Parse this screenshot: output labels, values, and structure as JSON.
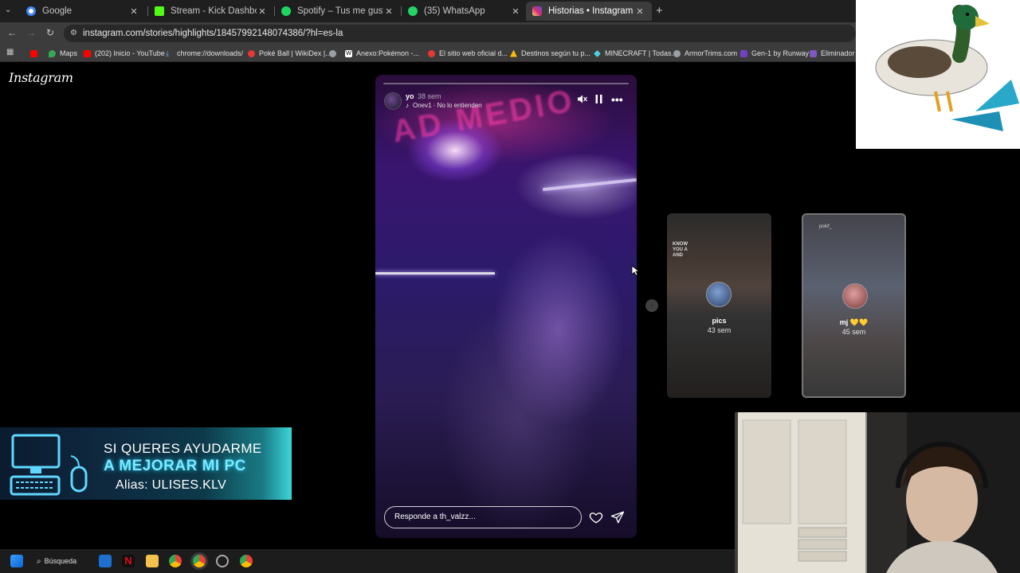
{
  "browser": {
    "tabs": [
      {
        "label": "Google",
        "icon": "google-icon",
        "color": "#4285f4",
        "active": false
      },
      {
        "label": "Stream - Kick Dashboard",
        "icon": "kick-icon",
        "color": "#53fc18",
        "active": false
      },
      {
        "label": "Spotify – Tus me gusta",
        "icon": "spotify-icon",
        "color": "#1ed760",
        "active": false
      },
      {
        "label": "(35) WhatsApp",
        "icon": "whatsapp-icon",
        "color": "#25d366",
        "active": false
      },
      {
        "label": "Historias • Instagram",
        "icon": "instagram-icon",
        "color": "#e1306c",
        "active": true
      }
    ],
    "new_tab": "+",
    "url": "instagram.com/stories/highlights/18457992148074386/?hl=es-la",
    "bookmarks": [
      {
        "label": "",
        "icon": "youtube-icon",
        "color": "#ff0000"
      },
      {
        "label": "Maps",
        "icon": "maps-icon",
        "color": "#34a853"
      },
      {
        "label": "(202) Inicio - YouTube",
        "icon": "youtube-icon",
        "color": "#ff0000"
      },
      {
        "label": "chrome://downloads/",
        "icon": "download-icon",
        "color": "#8ab4f8"
      },
      {
        "label": "Poké Ball | WikiDex |...",
        "icon": "pokeball-icon",
        "color": "#e53935"
      },
      {
        "label": "",
        "icon": "globe-icon",
        "color": "#9aa0a6"
      },
      {
        "label": "Anexo:Pokémon -...",
        "icon": "wikipedia-icon",
        "color": "#ffffff"
      },
      {
        "label": "El sitio web oficial d...",
        "icon": "pokeball-icon",
        "color": "#e53935"
      },
      {
        "label": "Destinos según tu p...",
        "icon": "arrow-icon",
        "color": "#fbbc04"
      },
      {
        "label": "MINECRAFT | Todas...",
        "icon": "diamond-icon",
        "color": "#4dd0e1"
      },
      {
        "label": "ArmorTrims.com",
        "icon": "globe-icon",
        "color": "#9aa0a6"
      },
      {
        "label": "Gen-1 by Runway",
        "icon": "runway-icon",
        "color": "#6f42c1"
      },
      {
        "label": "Eliminador d",
        "icon": "tool-icon",
        "color": "#7e57c2"
      }
    ]
  },
  "instagram": {
    "logo": "Instagram",
    "story": {
      "user": "yo",
      "time": "38 sem",
      "music": "Onev1 · No lo entienden",
      "reply_placeholder": "Responde a th_valzz...",
      "progress": 0.0,
      "neon_text": "AD MEDIO"
    },
    "previews": [
      {
        "label": "pics",
        "time": "43 sem",
        "overlay_text": "KNOW\nYOU A\nAND"
      },
      {
        "label": "mj 💛💛",
        "time": "45 sem",
        "overlay_user": "polcf_"
      }
    ]
  },
  "overlays": {
    "banner": {
      "line1": "SI QUERES AYUDARME",
      "line2": "A MEJORAR MI PC",
      "line3": "Alias: ULISES.KLV"
    }
  },
  "taskbar": {
    "search_label": "Búsqueda"
  }
}
